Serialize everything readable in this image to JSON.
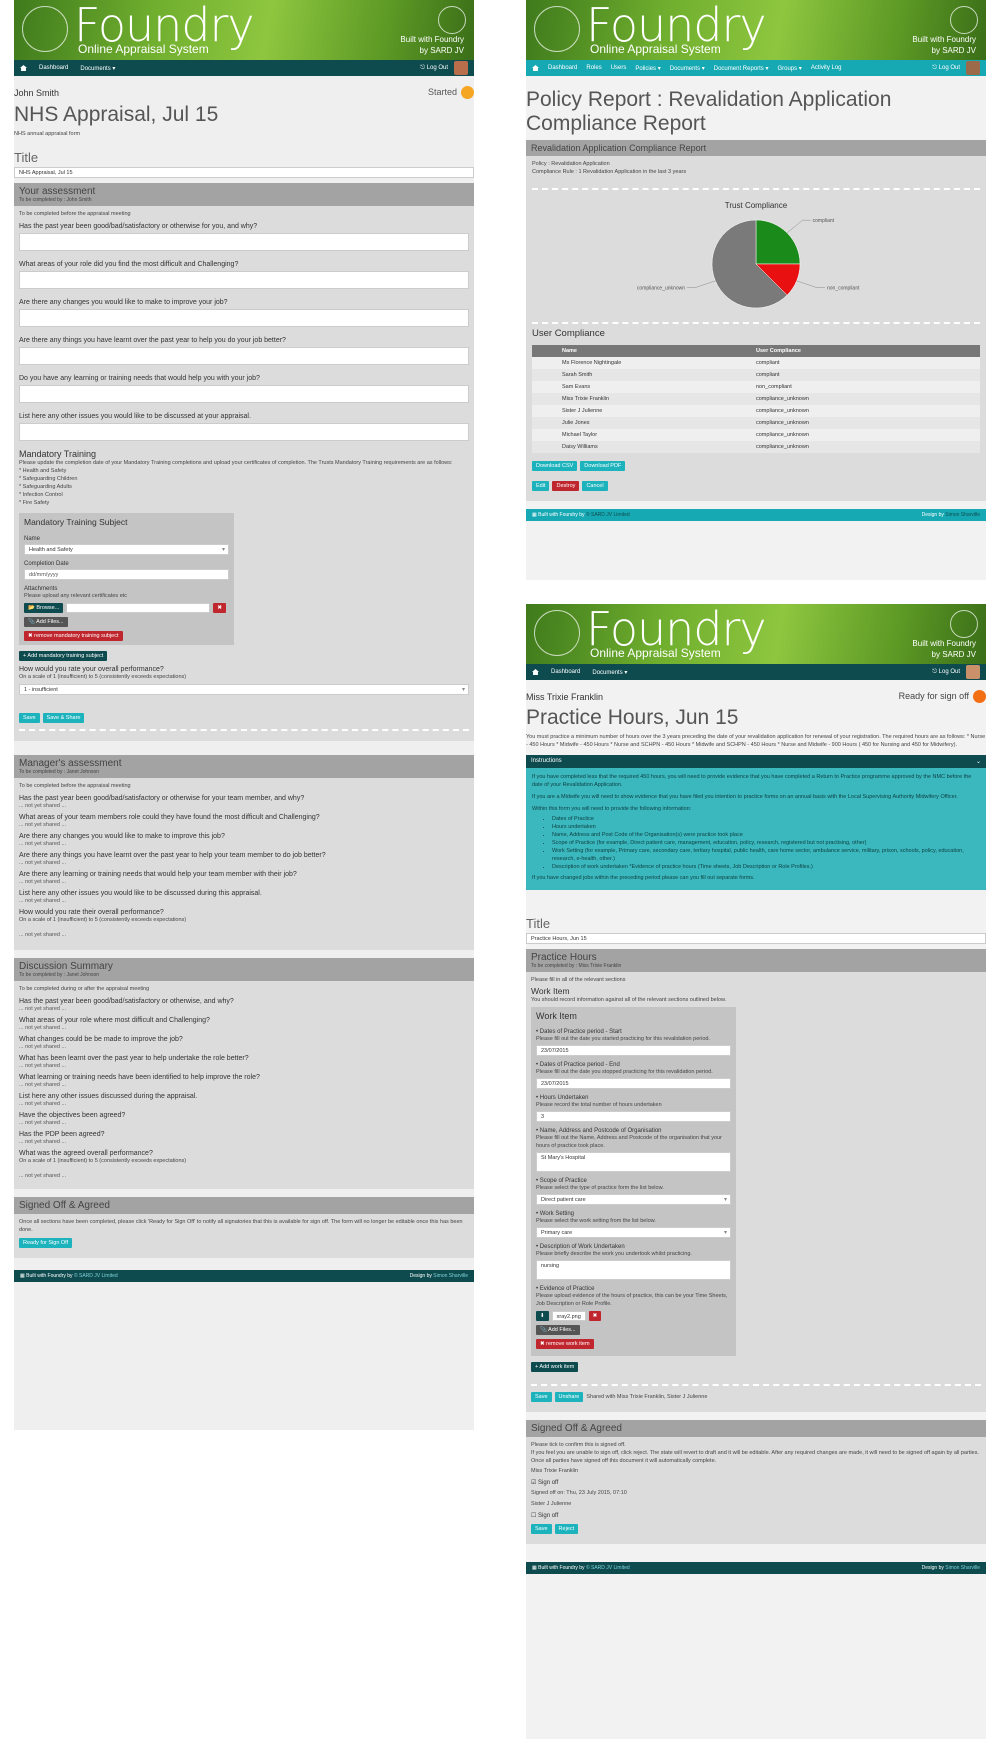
{
  "brand": {
    "name": "Foundry",
    "subtitle": "Online Appraisal System",
    "built_line1": "Built with Foundry",
    "built_line2": "by SARD JV"
  },
  "colors": {
    "accent": "#1cb3bd",
    "nav_dark": "#0e4b4f",
    "danger": "#c0262d",
    "started": "#f5a623",
    "ready": "#f36f13",
    "compliant": "#1a8a1a",
    "non_compliant": "#e81010",
    "unknown": "#7a7a7a"
  },
  "p1": {
    "nav": [
      "Dashboard",
      "Documents ▾"
    ],
    "logout": "Log Out",
    "user": "John Smith",
    "status": "Started",
    "doc_title": "NHS Appraisal, Jul 15",
    "doc_desc": "NHS annual appraisal form",
    "title_label": "Title",
    "title_value": "NHS Appraisal, Jul 15",
    "your": {
      "title": "Your assessment",
      "by": "To be completed by : John Smith",
      "note": "To be completed before the appraisal meeting",
      "questions": [
        "Has the past year been good/bad/satisfactory or otherwise for you, and why?",
        "What areas of your role did you find the most difficult and Challenging?",
        "Are there any changes you would like to make to improve your job?",
        "Are there any things you have learnt over the past year to help you do your job better?",
        "Do you have any learning or training needs that would help you with your job?",
        "List here any other issues you would like to be discussed at your appraisal."
      ],
      "mt_title": "Mandatory Training",
      "mt_desc": "Please update the completion date of your Mandatory Training completions and upload your certificates of completion. The Trusts Mandatory Training requirements are as follows:",
      "mt_items": [
        "* Health and Safety",
        "* Safeguarding Children",
        "* Safeguarding Adults",
        "* Infection Control",
        "* Fire Safety"
      ],
      "subject": {
        "title": "Mandatory Training Subject",
        "name_label": "Name",
        "name_value": "Health and Safety",
        "date_label": "Completion Date",
        "date_ph": "dd/mm/yyyy",
        "att_label": "Attachments",
        "att_note": "Please upload any relevant certificates etc",
        "browse": "Browse...",
        "add_files": "Add Files...",
        "remove": "✖ remove mandatory training subject"
      },
      "add_subject": "+ Add mandatory training subject",
      "rate_q": "How would you rate your overall performance?",
      "rate_note": "On a scale of 1 (insufficient) to 5 (consistently exceeds expectations)",
      "rate_value": "1 - insufficient",
      "save": "Save",
      "save_share": "Save & Share"
    },
    "mgr": {
      "title": "Manager's assessment",
      "by": "To be completed by : Janet Johnson",
      "note": "To be completed before the appraisal meeting",
      "questions": [
        "Has the past year been good/bad/satisfactory or otherwise for your team member, and why?",
        "What areas of your team members role could they have found the most difficult and Challenging?",
        "Are there any changes you would like to make to improve this job?",
        "Are there any things you have learnt over the past year to help your team member to do job better?",
        "Are there any learning or training needs that would help your team member with their job?",
        "List here any other issues you would like to be discussed during this appraisal."
      ],
      "rate_q": "How would you rate their overall performance?",
      "rate_note": "On a scale of 1 (insufficient) to 5 (consistently exceeds expectations)",
      "ns": "... not yet shared ..."
    },
    "disc": {
      "title": "Discussion Summary",
      "by": "To be completed by : Janet Johnson",
      "note": "To be completed during or after the appraisal meeting",
      "questions": [
        "Has the past year been good/bad/satisfactory or otherwise, and why?",
        "What areas of your role where most difficult and Challenging?",
        "What changes could be be made to improve the job?",
        "What has been learnt over the past year to help undertake the role better?",
        "What learning or training needs have been identified to help improve the role?",
        "List here any other issues discussed during the appraisal.",
        "Have the objectives been agreed?",
        "Has the PDP been agreed?"
      ],
      "rate_q": "What was the agreed overall performance?",
      "rate_note": "On a scale of 1 (insufficient) to 5 (consistently exceeds expectations)"
    },
    "signed": {
      "title": "Signed Off & Agreed",
      "text": "Once all sections have been completed, please click 'Ready for Sign Off' to notify all signatories that this is available for sign off. The form will no longer be editable once this has been done.",
      "button": "Ready for Sign Off"
    },
    "footer_left": "Built with Foundry by",
    "footer_link": "© SARD JV Limited",
    "footer_right": "Design by",
    "footer_right_link": "Simon Sharville"
  },
  "p2": {
    "nav": [
      "Dashboard",
      "Roles",
      "Users",
      "Policies ▾",
      "Documents ▾",
      "Document Reports ▾",
      "Groups ▾",
      "Activity Log"
    ],
    "logout": "Log Out",
    "title": "Policy Report : Revalidation Application Compliance Report",
    "section": "Revalidation Application Compliance Report",
    "policy": "Policy : Revalidation Application",
    "rule": "Compliance Rule : 1 Revalidation Application in the last 3 years",
    "user_compliance": "User Compliance",
    "col_name": "Name",
    "col_comp": "User Compliance",
    "rows": [
      [
        "Ms Florence Nightingale",
        "compliant"
      ],
      [
        "Sarah Smith",
        "compliant"
      ],
      [
        "Sam Evans",
        "non_compliant"
      ],
      [
        "Miss Trixie Franklin",
        "compliance_unknown"
      ],
      [
        "Sister J Julienne",
        "compliance_unknown"
      ],
      [
        "Julie Jones",
        "compliance_unknown"
      ],
      [
        "Michael Taylor",
        "compliance_unknown"
      ],
      [
        "Daisy Williams",
        "compliance_unknown"
      ]
    ],
    "dl_csv": "Download CSV",
    "dl_pdf": "Download PDF",
    "edit": "Edit",
    "destroy": "Destroy",
    "cancel": "Cancel",
    "footer_left": "Built with Foundry by",
    "footer_link": "© SARD JV Limited",
    "footer_right": "Design by",
    "footer_right_link": "Simon Sharville"
  },
  "chart_data": {
    "type": "pie",
    "title": "Trust Compliance",
    "categories": [
      "compliant",
      "non_compliant",
      "compliance_unknown"
    ],
    "values": [
      2,
      1,
      5
    ]
  },
  "p3": {
    "nav": [
      "Dashboard",
      "Documents ▾"
    ],
    "logout": "Log Out",
    "user": "Miss Trixie Franklin",
    "status": "Ready for sign off",
    "doc_title": "Practice Hours, Jun 15",
    "intro": "You must practice a minimum number of hours over the 3 years preceding the date of your revalidation application for renewal of your registration. The required hours are as follows: * Nurse - 450 Hours * Midwife - 450 Hours * Nurse and SCHPN - 450 Hours * Midwife and SCHPN - 450 Hours * Nurse and Midwife - 900 Hours ( 450 for Nursing and 450 for Midwifery).",
    "instr_title": "Instructions",
    "instr_p1": "If you have completed less that the required 450 hours, you will need to provide evidence that you have completed a Return to Practice programme approved by the NMC before the date of your Revalidation Application.",
    "instr_p2": "If you are a Midwife you will need to show evidence that you have filed you intention to practice forms on an annual basis with the Local Supervising Authority Midwifery Officer.",
    "instr_p3": "Within this form you will need to provide the following information:",
    "instr_items": [
      "Dates of Practice",
      "Hours undertaken",
      "Name, Address and Post Code of the Organisation(s) were practice took place",
      "Scope of Practice (for example, Direct patient care, management, education, policy, research, registered but not practising, other)",
      "Work Setting (for example, Primary care, secondary care, tertiary hospital, public health, care home sector, ambulance service, military, prison, schools, policy, education, research, e-health, other.)",
      "Description of work undertaken *Evidence of practice hours (Time sheets, Job Description or Role Profiles.)"
    ],
    "instr_p4": "If you have changed jobs within the preceding period please can you fill out separate forms.",
    "title_label": "Title",
    "title_value": "Practice Hours, Jun 15",
    "ph_title": "Practice Hours",
    "ph_by": "To be completed by : Miss Trixie Franklin",
    "ph_note": "Please fill in all of the relevant sections",
    "wi_label": "Work Item",
    "wi_note": "You should record information against all of the relevant sections outlined below.",
    "wi": {
      "title": "Work Item",
      "start_l": "• Dates of Practice period - Start",
      "start_n": "Please fill out the date you started practicing for this revalidation period.",
      "start_v": "23/07/2015",
      "end_l": "• Dates of Practice period - End",
      "end_n": "Please fill out the date you stopped practicing for this revalidation period.",
      "end_v": "23/07/2015",
      "hours_l": "• Hours Undertaken",
      "hours_n": "Please record the total number of hours undertaken",
      "hours_v": "3",
      "org_l": "• Name, Address and Postcode of Organisation",
      "org_n": "Please fill out the Name, Address and Postcode of the organisation that your hours of practice took place.",
      "org_v": "St Mary's Hospital",
      "scope_l": "• Scope of Practice",
      "scope_n": "Please select the type of practice form the list below.",
      "scope_v": "Direct patient care",
      "ws_l": "• Work Setting",
      "ws_n": "Please select the work setting from the list below.",
      "ws_v": "Primary care",
      "desc_l": "• Description of Work Undertaken",
      "desc_n": "Please briefly describe the work you undertook whilst practicing.",
      "desc_v": "nursing",
      "ev_l": "• Evidence of Practice",
      "ev_n": "Please upload evidence of the hours of practice, this can be your Time Sheets, Job Description or Role Profile.",
      "ev_file": "xray2.png",
      "add_files": "Add Files...",
      "remove": "✖ remove work item"
    },
    "add_wi": "+ Add work item",
    "save": "Save",
    "unshare": "Unshare",
    "shared": "Shared with Miss Trixie Franklin, Sister J Julienne",
    "so_title": "Signed Off & Agreed",
    "so_t1": "Please tick to confirm this is signed off.",
    "so_t2": "If you feel you are unable to sign off, click reject. The state will revert to draft and it will be editable. After any required changes are made, it will need to be signed off again by all parties.",
    "so_t3": "Once all parties have signed off this document it will automatically complete.",
    "so_p1": "Miss Trixie Franklin",
    "so_sign": "Sign off",
    "so_signed": "Signed off on: Thu, 23 July 2015, 07:10",
    "so_p2": "Sister J Julienne",
    "reject": "Reject",
    "footer_left": "Built with Foundry by",
    "footer_link": "© SARD JV Limited",
    "footer_right": "Design by",
    "footer_right_link": "Simon Sharville"
  }
}
